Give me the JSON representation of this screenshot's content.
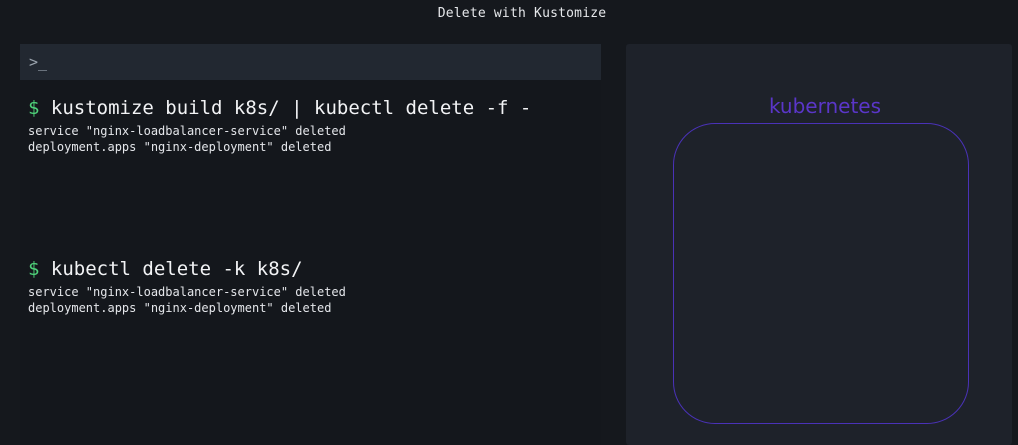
{
  "title": "Delete with Kustomize",
  "terminal": {
    "prompt_icon": ">_",
    "commands": [
      {
        "prompt": "$",
        "command": "kustomize build k8s/ | kubectl delete -f -",
        "output": [
          "service \"nginx-loadbalancer-service\" deleted",
          "deployment.apps \"nginx-deployment\" deleted"
        ]
      },
      {
        "prompt": "$",
        "command": "kubectl delete -k k8s/",
        "output": [
          "service \"nginx-loadbalancer-service\" deleted",
          "deployment.apps \"nginx-deployment\" deleted"
        ]
      }
    ]
  },
  "cluster": {
    "label": "kubernetes"
  },
  "colors": {
    "prompt": "#4fd27a",
    "cluster_accent": "#5a36c9"
  }
}
